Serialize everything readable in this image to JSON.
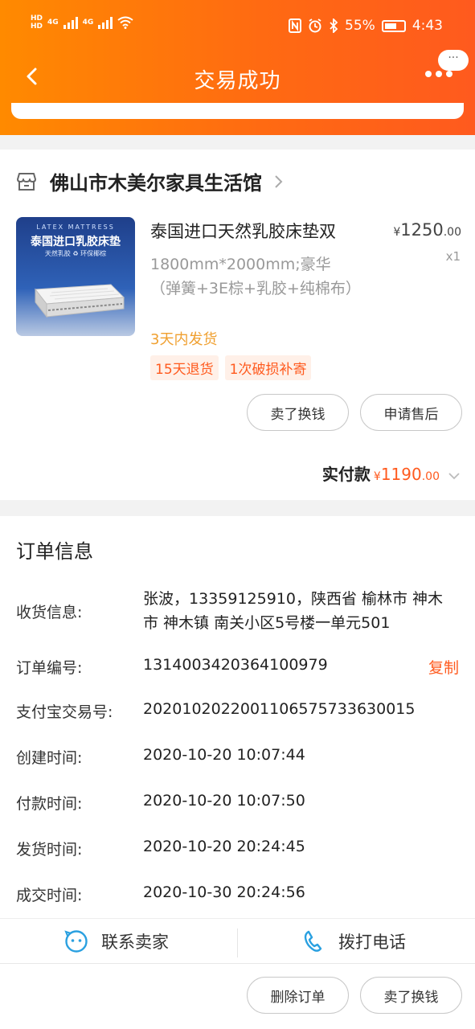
{
  "status_bar": {
    "hd1": "HD",
    "hd2": "HD",
    "net1": "4G",
    "net2": "4G",
    "battery": "55%",
    "time": "4:43"
  },
  "header": {
    "title": "交易成功",
    "more": "···"
  },
  "shop": {
    "name": "佛山市木美尔家具生活馆"
  },
  "product": {
    "image_line1": "LATEX MATTRESS",
    "image_line2": "泰国进口乳胶床垫",
    "image_line3": "天然乳胶  ♻ 环保椰棕",
    "title": "泰国进口天然乳胶床垫双",
    "sku": "1800mm*2000mm;豪华（弹簧+3E棕+乳胶+纯棉布）",
    "shipping": "3天内发货",
    "tags": [
      "15天退货",
      "1次破损补寄"
    ],
    "price_currency": "¥",
    "price_int": "1250",
    "price_dec": ".00",
    "quantity": "x1"
  },
  "actions": {
    "sell": "卖了换钱",
    "after_sale": "申请售后"
  },
  "paid": {
    "label": "实付款",
    "currency": "¥",
    "int": "1190",
    "dec": ".00"
  },
  "order_info": {
    "title": "订单信息",
    "rows": [
      {
        "label": "收货信息:",
        "value": "张波，13359125910，陕西省 榆林市 神木市 神木镇 南关小区5号楼一单元501"
      },
      {
        "label": "订单编号:",
        "value": "1314003420364100979"
      },
      {
        "label": "支付宝交易号:",
        "value": "2020102022001106575733630015"
      },
      {
        "label": "创建时间:",
        "value": "2020-10-20 10:07:44"
      },
      {
        "label": "付款时间:",
        "value": "2020-10-20 10:07:50"
      },
      {
        "label": "发货时间:",
        "value": "2020-10-20 20:24:45"
      },
      {
        "label": "成交时间:",
        "value": "2020-10-30 20:24:56"
      }
    ],
    "copy": "复制"
  },
  "contact": {
    "seller": "联系卖家",
    "phone": "拨打电话"
  },
  "bottom": {
    "delete": "删除订单",
    "sell": "卖了换钱"
  },
  "colors": {
    "accent": "#ff5a1e",
    "header_start": "#ff8a00",
    "ship": "#f0a030",
    "icon_blue": "#2aa0e0"
  }
}
